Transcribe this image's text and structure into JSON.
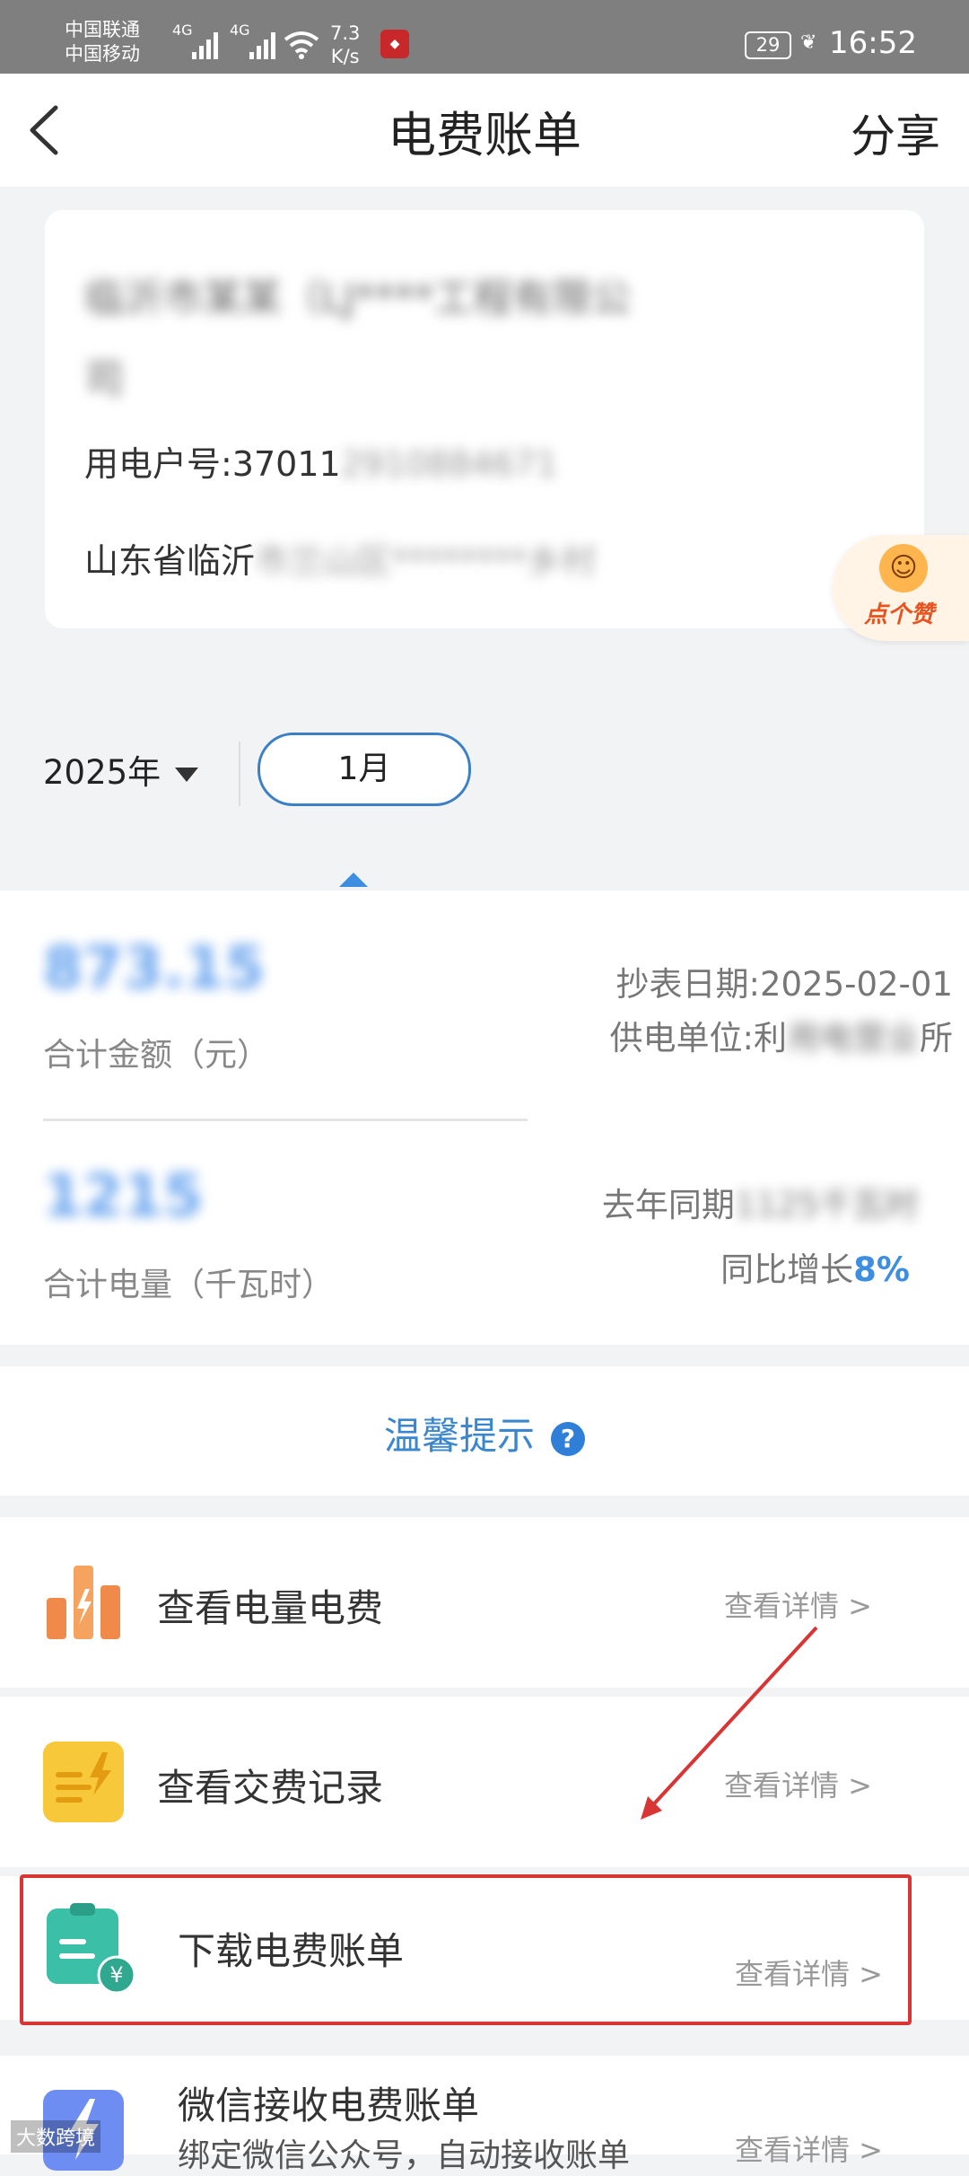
{
  "status_bar": {
    "carrier1": "中国联通",
    "carrier2": "中国移动",
    "net1": "4G",
    "net2": "4G",
    "speed_value": "7.3",
    "speed_unit": "K/s",
    "battery": "29",
    "time": "16:52"
  },
  "header": {
    "title": "电费账单",
    "share_label": "分享"
  },
  "account": {
    "name_line1": "临沂市某某（LJ****工程有限公",
    "name_line2": "司",
    "number_label": "用电户号:37011",
    "number_hidden": "2910884671",
    "address_visible": "山东省临沂",
    "address_hidden": "市兰山区********乡村"
  },
  "like_badge": {
    "label": "点个赞"
  },
  "period": {
    "year": "2025年",
    "month": "1月"
  },
  "summary": {
    "amount_value": "873.15",
    "amount_caption": "合计金额（元）",
    "meter_date": "抄表日期:2025-02-01",
    "supplier_prefix": "供电单位:利",
    "supplier_hidden": "用电营业",
    "supplier_suffix": "所",
    "usage_value": "1215",
    "usage_caption": "合计电量（千瓦时）",
    "last_year_prefix": "去年同期",
    "last_year_hidden": "1125千瓦时",
    "yoy_label": "同比增长",
    "yoy_value": "8%"
  },
  "tips": {
    "label": "温馨提示",
    "icon": "?"
  },
  "menu": [
    {
      "label": "查看电量电费",
      "detail": "查看详情 >"
    },
    {
      "label": "查看交费记录",
      "detail": "查看详情 >"
    },
    {
      "label": "下载电费账单",
      "detail": "查看详情 >"
    },
    {
      "label": "微信接收电费账单",
      "sublabel": "绑定微信公众号，自动接收账单",
      "detail": "查看详情 >"
    }
  ],
  "watermark": "大数跨境",
  "colors": {
    "accent": "#3d8de0",
    "highlight_red": "#d83535",
    "status_bar_bg": "#7f7f7f"
  }
}
